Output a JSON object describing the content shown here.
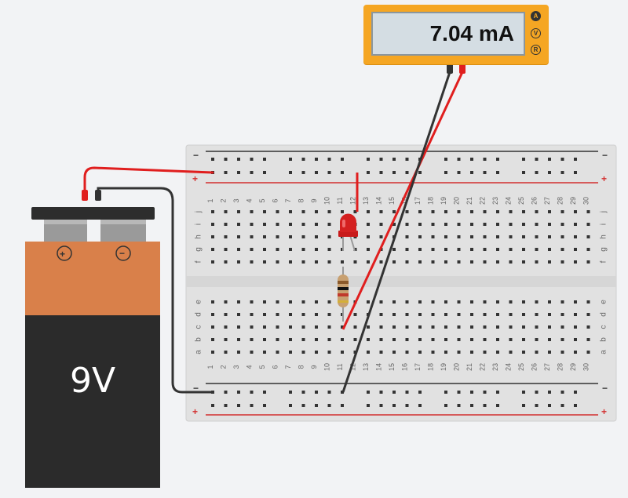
{
  "multimeter": {
    "reading": "7.04 mA",
    "modes": [
      {
        "label": "A",
        "active": true
      },
      {
        "label": "V",
        "active": false
      },
      {
        "label": "R",
        "active": false
      }
    ]
  },
  "battery": {
    "label": "9V",
    "positive_symbol": "+",
    "negative_symbol": "−"
  },
  "breadboard": {
    "columns": 30,
    "column_labels": [
      "1",
      "2",
      "3",
      "4",
      "5",
      "6",
      "7",
      "8",
      "9",
      "10",
      "11",
      "12",
      "13",
      "14",
      "15",
      "16",
      "17",
      "18",
      "19",
      "20",
      "21",
      "22",
      "23",
      "24",
      "25",
      "26",
      "27",
      "28",
      "29",
      "30"
    ],
    "top_rows": [
      "j",
      "i",
      "h",
      "g",
      "f"
    ],
    "bottom_rows": [
      "e",
      "d",
      "c",
      "b",
      "a"
    ],
    "rail_negative": "−",
    "rail_positive": "+"
  },
  "components": [
    {
      "type": "led",
      "color": "#d42020"
    },
    {
      "type": "resistor",
      "color": "#c8a070"
    }
  ],
  "colors": {
    "wire_red": "#e01e1e",
    "wire_black": "#333333",
    "meter_body": "#f5a623",
    "battery_top": "#d9804a",
    "battery_bottom": "#2b2b2b"
  }
}
